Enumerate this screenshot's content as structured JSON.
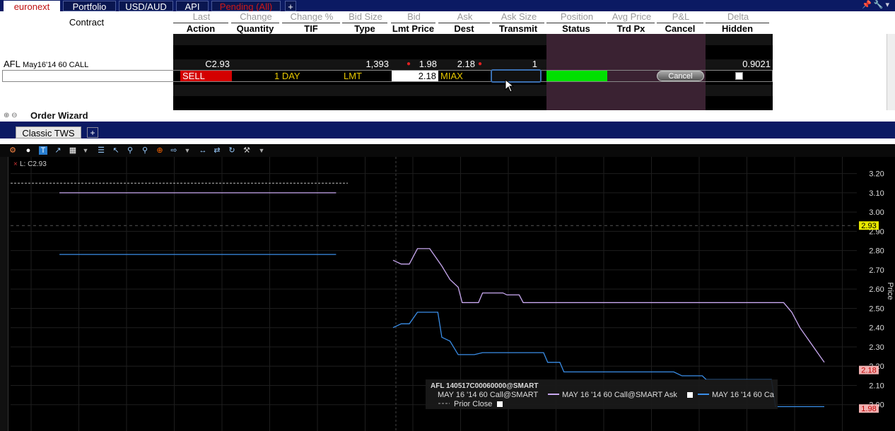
{
  "top_tabs": [
    {
      "label": "euronext",
      "active": true
    },
    {
      "label": "Portfolio"
    },
    {
      "label": "USD/AUD"
    },
    {
      "label": "API"
    },
    {
      "label": "Pending (All)"
    },
    {
      "label": "+"
    }
  ],
  "header": {
    "contract": "Contract",
    "row1": [
      "Last",
      "Change",
      "Change %",
      "Bid Size",
      "Bid",
      "Ask",
      "Ask Size",
      "Position",
      "Avg Price",
      "P&L",
      "Delta"
    ],
    "row2": [
      "Action",
      "Quantity",
      "TIF",
      "Type",
      "Lmt Price",
      "Dest",
      "Transmit",
      "Status",
      "Trd Px",
      "Cancel",
      "Hidden"
    ]
  },
  "quote_row": {
    "contract": "AFL",
    "contract_detail": "May16'14 60 CALL",
    "last": "C2.93",
    "bid_size": "1,393",
    "bid": "1.98",
    "ask": "2.18",
    "ask_size": "1",
    "delta": "0.9021"
  },
  "order_row": {
    "action": "SELL",
    "tif": "1 DAY",
    "type": "LMT",
    "lmt_price": "2.18",
    "dest": "MIAX",
    "cancel_label": "Cancel"
  },
  "order_wizard": {
    "title": "Order Wizard"
  },
  "bottom_tabs": {
    "classic": "Classic TWS",
    "plus": "+"
  },
  "chart_data": {
    "type": "line",
    "corner_label": "L: C2.93",
    "ylabel": "Price",
    "ylim": [
      1.9,
      3.25
    ],
    "yticks": [
      "3.20",
      "3.10",
      "3.00",
      "2.90",
      "2.80",
      "2.70",
      "2.60",
      "2.50",
      "2.40",
      "2.30",
      "2.20",
      "2.10",
      "2.00"
    ],
    "markers": [
      {
        "label": "2.93",
        "value": 2.93,
        "color": "#e8e800",
        "text_color": "#000"
      },
      {
        "label": "2.18",
        "value": 2.18,
        "color": "#f0b0b0",
        "text_color": "#c00000"
      },
      {
        "label": "1.98",
        "value": 1.98,
        "color": "#f0b0b0",
        "text_color": "#c00000"
      }
    ],
    "prior_close": 3.15,
    "series": [
      {
        "name": "MAY 16 '14 60 Call@SMART Ask",
        "color": "#c8a8f0",
        "segments": [
          [
            [
              0.06,
              3.1
            ],
            [
              0.4,
              3.1
            ]
          ],
          [
            [
              0.47,
              2.75
            ],
            [
              0.48,
              2.73
            ],
            [
              0.49,
              2.73
            ],
            [
              0.5,
              2.81
            ],
            [
              0.515,
              2.81
            ],
            [
              0.53,
              2.72
            ],
            [
              0.54,
              2.65
            ],
            [
              0.55,
              2.61
            ],
            [
              0.555,
              2.53
            ],
            [
              0.575,
              2.53
            ],
            [
              0.58,
              2.58
            ],
            [
              0.605,
              2.58
            ],
            [
              0.61,
              2.57
            ],
            [
              0.625,
              2.57
            ],
            [
              0.63,
              2.53
            ],
            [
              0.95,
              2.53
            ],
            [
              0.96,
              2.48
            ],
            [
              0.97,
              2.4
            ],
            [
              1.0,
              2.22
            ]
          ]
        ]
      },
      {
        "name": "MAY 16 '14 60 Ca",
        "color": "#3a8ee8",
        "segments": [
          [
            [
              0.06,
              2.78
            ],
            [
              0.4,
              2.78
            ]
          ],
          [
            [
              0.47,
              2.4
            ],
            [
              0.48,
              2.42
            ],
            [
              0.49,
              2.42
            ],
            [
              0.5,
              2.48
            ],
            [
              0.525,
              2.48
            ],
            [
              0.53,
              2.35
            ],
            [
              0.54,
              2.33
            ],
            [
              0.55,
              2.26
            ],
            [
              0.57,
              2.26
            ],
            [
              0.58,
              2.27
            ],
            [
              0.655,
              2.27
            ],
            [
              0.66,
              2.22
            ],
            [
              0.675,
              2.22
            ],
            [
              0.68,
              2.17
            ],
            [
              0.815,
              2.17
            ],
            [
              0.825,
              2.15
            ],
            [
              0.85,
              2.15
            ],
            [
              0.855,
              2.13
            ],
            [
              0.935,
              2.13
            ],
            [
              0.94,
              1.99
            ],
            [
              1.0,
              1.99
            ]
          ]
        ]
      }
    ],
    "legend": {
      "symbol": "AFL 140517C00060000@SMART",
      "entries": [
        "MAY 16 '14 60 Call@SMART",
        "MAY 16 '14 60 Call@SMART Ask",
        "MAY 16 '14 60 Ca"
      ],
      "prior_close_label": "Prior Close"
    },
    "grid": true
  }
}
